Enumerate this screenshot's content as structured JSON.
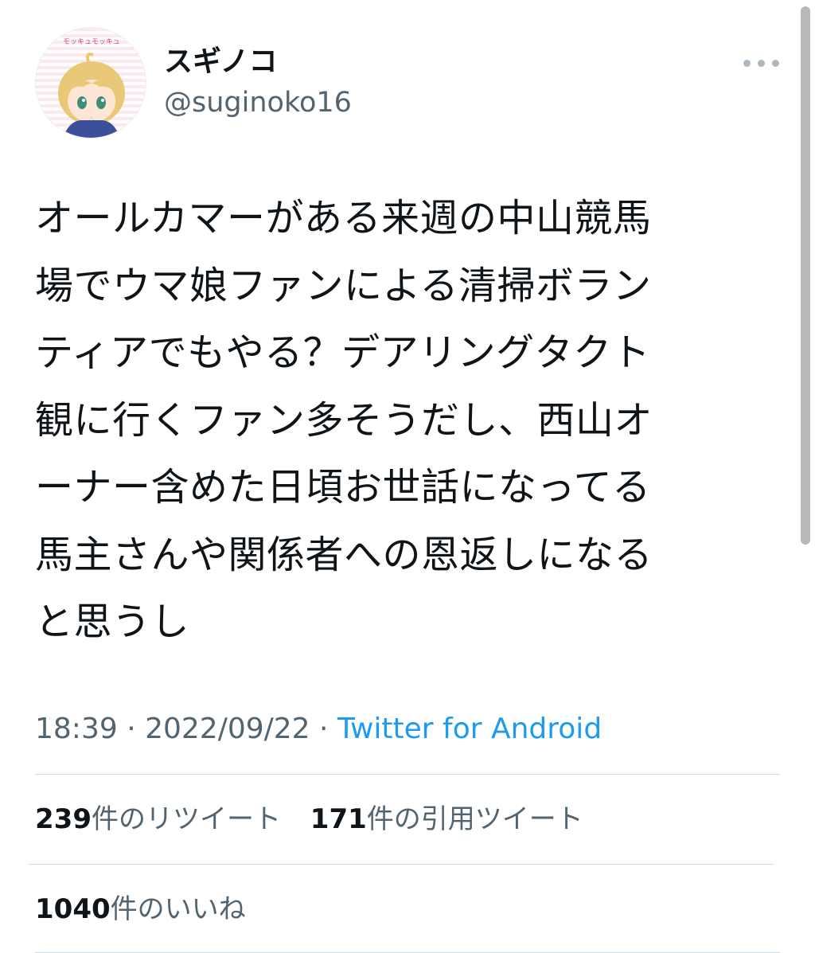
{
  "author": {
    "display_name": "スギノコ",
    "handle": "@suginoko16",
    "avatar_text": "モッキュモッキュ"
  },
  "tweet": {
    "lines": [
      "オールカマーがある来週の中山競馬",
      "場でウマ娘ファンによる清掃ボラン",
      "ティアでもやる？デアリングタクト",
      "観に行くファン多そうだし、西山オ",
      "ーナー含めた日頃お世話になってる",
      "馬主さんや関係者への恩返しになる",
      "と思うし"
    ]
  },
  "meta": {
    "time": "18:39",
    "separator": " · ",
    "date": "2022/09/22",
    "source": "Twitter for Android"
  },
  "stats": {
    "retweets_count": "239",
    "retweets_label": "件のリツイート",
    "quotes_count": "171",
    "quotes_label": "件の引用ツイート",
    "likes_count": "1040",
    "likes_label": "件のいいね"
  },
  "colors": {
    "text": "#0f1419",
    "secondary": "#536471",
    "link": "#1d9bf0",
    "divider": "#cfd9de"
  },
  "icons": {
    "more": "more-horizontal-icon"
  }
}
